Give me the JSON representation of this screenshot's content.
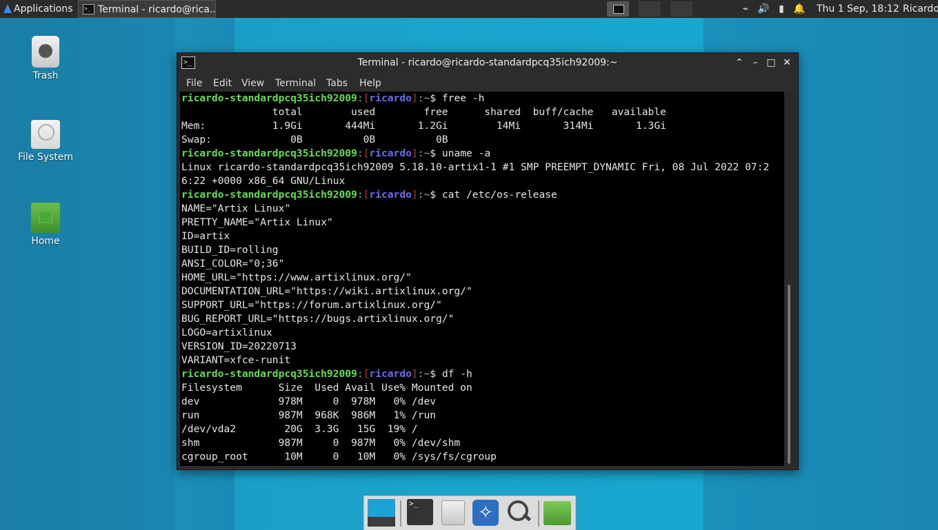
{
  "panel": {
    "apps_label": "Applications",
    "apps_overflow": "⋮",
    "task_label": "Terminal - ricardo@rica...",
    "clock": "Thu  1 Sep, 18:12",
    "user": "Ricardo",
    "icons": [
      "network-icon",
      "volume-icon",
      "battery-icon",
      "notification-bell-icon"
    ]
  },
  "desktop": {
    "trash": "Trash",
    "filesystem": "File System",
    "home": "Home"
  },
  "window": {
    "title": "Terminal - ricardo@ricardo-standardpcq35ich92009:~",
    "menu": [
      "File",
      "Edit",
      "View",
      "Terminal",
      "Tabs",
      "Help"
    ]
  },
  "prompt": {
    "host": "ricardo-standardpcq35ich92009",
    "sep": ":",
    "lbr": "[",
    "user": "ricardo",
    "rbr": "]",
    "dir": ":~",
    "dollar": "$"
  },
  "terminal": {
    "cmd_free": " free -h",
    "free_header": "               total        used        free      shared  buff/cache   available",
    "free_mem": "Mem:           1.9Gi       444Mi       1.2Gi        14Mi       314Mi       1.3Gi",
    "free_swap": "Swap:             0B          0B          0B",
    "cmd_uname": " uname -a",
    "uname_1": "Linux ricardo-standardpcq35ich92009 5.18.10-artix1-1 #1 SMP PREEMPT_DYNAMIC Fri, 08 Jul 2022 07:2",
    "uname_2": "6:22 +0000 x86_64 GNU/Linux",
    "cmd_cat": " cat /etc/os-release",
    "os": [
      "NAME=\"Artix Linux\"",
      "PRETTY_NAME=\"Artix Linux\"",
      "ID=artix",
      "BUILD_ID=rolling",
      "ANSI_COLOR=\"0;36\"",
      "HOME_URL=\"https://www.artixlinux.org/\"",
      "DOCUMENTATION_URL=\"https://wiki.artixlinux.org/\"",
      "SUPPORT_URL=\"https://forum.artixlinux.org/\"",
      "BUG_REPORT_URL=\"https://bugs.artixlinux.org/\"",
      "LOGO=artixlinux",
      "VERSION_ID=20220713",
      "VARIANT=xfce-runit"
    ],
    "cmd_df": " df -h",
    "df": [
      "Filesystem      Size  Used Avail Use% Mounted on",
      "dev             978M     0  978M   0% /dev",
      "run             987M  968K  986M   1% /run",
      "/dev/vda2        20G  3.3G   15G  19% /",
      "shm             987M     0  987M   0% /dev/shm",
      "cgroup_root      10M     0   10M   0% /sys/fs/cgroup"
    ]
  },
  "dock": {
    "items": [
      "show-desktop",
      "terminal",
      "file-manager",
      "web-browser",
      "app-finder",
      "home-folder"
    ]
  }
}
